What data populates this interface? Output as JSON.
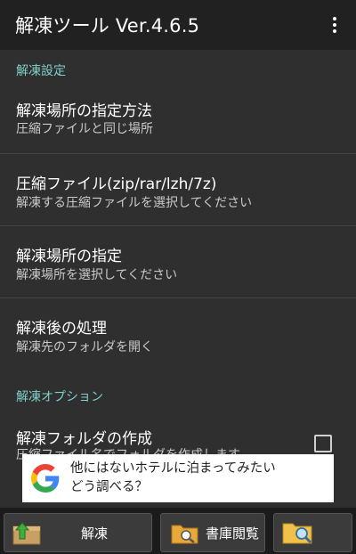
{
  "appbar": {
    "title": "解凍ツール Ver.4.6.5",
    "menu_icon": "more-vert-icon"
  },
  "sections": {
    "settings_header": "解凍設定",
    "options_header": "解凍オプション"
  },
  "settings": [
    {
      "title": "解凍場所の指定方法",
      "summary": "圧縮ファイルと同じ場所"
    },
    {
      "title": "圧縮ファイル(zip/rar/lzh/7z)",
      "summary": "解凍する圧縮ファイルを選択してください"
    },
    {
      "title": "解凍場所の指定",
      "summary": "解凍場所を選択してください"
    },
    {
      "title": "解凍後の処理",
      "summary": "解凍先のフォルダを開く"
    }
  ],
  "options": [
    {
      "title": "解凍フォルダの作成",
      "summary": "圧縮ファイル名でフォルダを作成します",
      "checked": false
    }
  ],
  "ad": {
    "line1": "他にはないホテルに泊まってみたい",
    "line2": "どう調べる？"
  },
  "bottom_buttons": {
    "extract": "解凍",
    "library": "書庫閲覧"
  },
  "colors": {
    "accent": "#7ecfc9",
    "background": "#2f2f2f",
    "appbar": "#212121"
  }
}
